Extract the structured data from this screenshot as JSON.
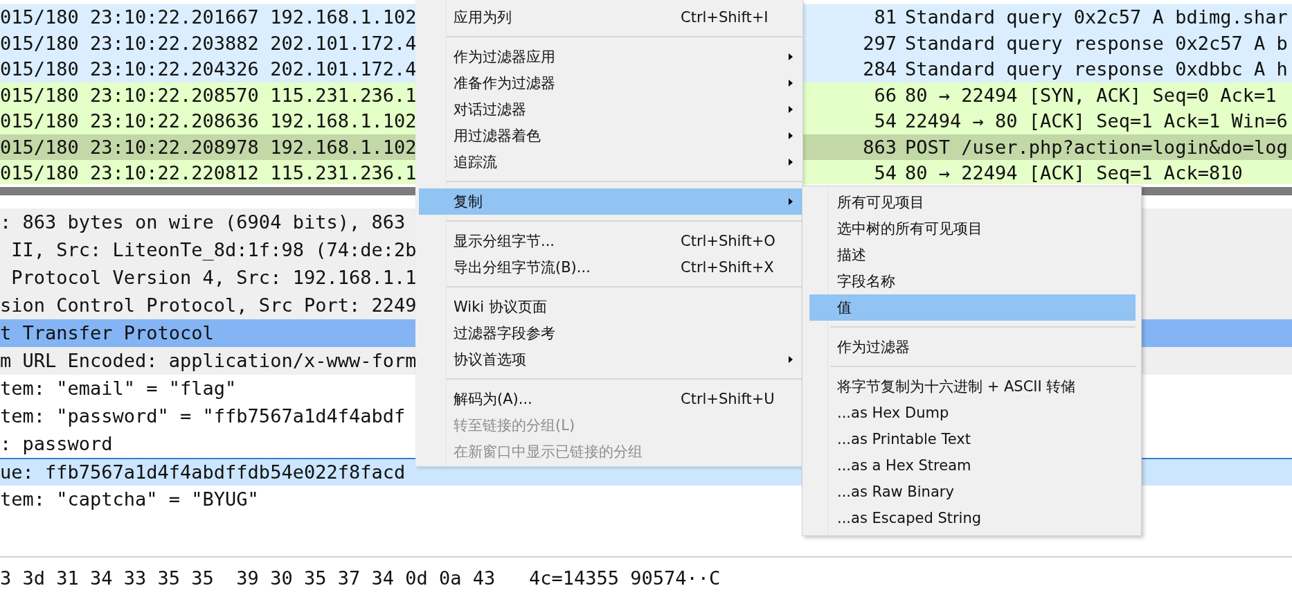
{
  "packet_list": {
    "rows": [
      {
        "summary": "015/180 23:10:22.201667 192.168.1.102",
        "length": "81",
        "info": "Standard query 0x2c57 A bdimg.shar",
        "color": "#daeeff"
      },
      {
        "summary": "015/180 23:10:22.203882 202.101.172.4",
        "length": "297",
        "info": "Standard query response 0x2c57 A b",
        "color": "#daeeff"
      },
      {
        "summary": "015/180 23:10:22.204326 202.101.172.4",
        "length": "284",
        "info": "Standard query response 0xdbbc A h",
        "color": "#daeeff"
      },
      {
        "summary": "015/180 23:10:22.208570 115.231.236.1",
        "length": "66",
        "info": "80 → 22494 [SYN, ACK] Seq=0 Ack=1",
        "color": "#e4ffc7"
      },
      {
        "summary": "015/180 23:10:22.208636 192.168.1.102",
        "length": "54",
        "info": "22494 → 80 [ACK] Seq=1 Ack=1 Win=6",
        "color": "#e4ffc7"
      },
      {
        "summary": "015/180 23:10:22.208978 192.168.1.102",
        "length": "863",
        "info": "POST /user.php?action=login&do=log",
        "color": "#c2d8a7"
      },
      {
        "summary": "015/180 23:10:22.220812 115.231.236.1",
        "length": "54",
        "info": "80 → 22494 [ACK] Seq=1 Ack=810",
        "color": "#e4ffc7"
      }
    ]
  },
  "packet_details": {
    "rows": [
      {
        "text": ": 863 bytes on wire (6904 bits), 863",
        "kind": "protocol",
        "selected": false,
        "highlighted": false
      },
      {
        "text": " II, Src: LiteonTe_8d:1f:98 (74:de:2b",
        "kind": "protocol",
        "selected": false,
        "highlighted": false
      },
      {
        "text": " Protocol Version 4, Src: 192.168.1.1",
        "kind": "protocol",
        "selected": false,
        "highlighted": false
      },
      {
        "text": "sion Control Protocol, Src Port: 2249",
        "kind": "protocol",
        "selected": false,
        "highlighted": false
      },
      {
        "text": "t Transfer Protocol",
        "kind": "protocol",
        "selected": true,
        "highlighted": false
      },
      {
        "text": "m URL Encoded: application/x-www-form",
        "kind": "protocol",
        "selected": false,
        "highlighted": false
      },
      {
        "text": "tem: \"email\" = \"flag\"",
        "kind": "field",
        "selected": false,
        "highlighted": false
      },
      {
        "text": "tem: \"password\" = \"ffb7567a1d4f4abdf",
        "kind": "field",
        "selected": false,
        "highlighted": false
      },
      {
        "text": ": password",
        "kind": "field",
        "selected": false,
        "highlighted": false
      },
      {
        "text": "ue: ffb7567a1d4f4abdffdb54e022f8facd",
        "kind": "field",
        "selected": false,
        "highlighted": true
      },
      {
        "text": "tem: \"captcha\" = \"BYUG\"",
        "kind": "field",
        "selected": false,
        "highlighted": false
      }
    ]
  },
  "packet_bytes": {
    "line": "3 3d 31 34 33 35 35  39 30 35 37 34 0d 0a 43   4c=14355 90574··C"
  },
  "context_menu": {
    "items": [
      {
        "kind": "item",
        "label": "应用为列",
        "shortcut": "Ctrl+Shift+I",
        "submenu": false,
        "disabled": false,
        "selected": false
      },
      {
        "kind": "separator"
      },
      {
        "kind": "item",
        "label": "作为过滤器应用",
        "submenu": true,
        "disabled": false,
        "selected": false
      },
      {
        "kind": "item",
        "label": "准备作为过滤器",
        "submenu": true,
        "disabled": false,
        "selected": false
      },
      {
        "kind": "item",
        "label": "对话过滤器",
        "submenu": true,
        "disabled": false,
        "selected": false
      },
      {
        "kind": "item",
        "label": "用过滤器着色",
        "submenu": true,
        "disabled": false,
        "selected": false
      },
      {
        "kind": "item",
        "label": "追踪流",
        "submenu": true,
        "disabled": false,
        "selected": false
      },
      {
        "kind": "separator"
      },
      {
        "kind": "item",
        "label": "复制",
        "submenu": true,
        "disabled": false,
        "selected": true
      },
      {
        "kind": "separator"
      },
      {
        "kind": "item",
        "label": "显示分组字节...",
        "shortcut": "Ctrl+Shift+O",
        "submenu": false,
        "disabled": false,
        "selected": false
      },
      {
        "kind": "item",
        "label": "导出分组字节流(B)...",
        "shortcut": "Ctrl+Shift+X",
        "submenu": false,
        "disabled": false,
        "selected": false
      },
      {
        "kind": "separator"
      },
      {
        "kind": "item",
        "label": "Wiki 协议页面",
        "submenu": false,
        "disabled": false,
        "selected": false
      },
      {
        "kind": "item",
        "label": "过滤器字段参考",
        "submenu": false,
        "disabled": false,
        "selected": false
      },
      {
        "kind": "item",
        "label": "协议首选项",
        "submenu": true,
        "disabled": false,
        "selected": false
      },
      {
        "kind": "separator"
      },
      {
        "kind": "item",
        "label": "解码为(A)...",
        "shortcut": "Ctrl+Shift+U",
        "submenu": false,
        "disabled": false,
        "selected": false
      },
      {
        "kind": "item",
        "label": "转至链接的分组(L)",
        "submenu": false,
        "disabled": true,
        "selected": false
      },
      {
        "kind": "item",
        "label": "在新窗口中显示已链接的分组",
        "submenu": false,
        "disabled": true,
        "selected": false
      }
    ]
  },
  "copy_submenu": {
    "items": [
      {
        "kind": "item",
        "label": "所有可见项目",
        "selected": false
      },
      {
        "kind": "item",
        "label": "选中树的所有可见项目",
        "selected": false
      },
      {
        "kind": "item",
        "label": "描述",
        "selected": false
      },
      {
        "kind": "item",
        "label": "字段名称",
        "selected": false
      },
      {
        "kind": "item",
        "label": "值",
        "selected": true
      },
      {
        "kind": "separator"
      },
      {
        "kind": "item",
        "label": "作为过滤器",
        "selected": false
      },
      {
        "kind": "separator"
      },
      {
        "kind": "item",
        "label": "将字节复制为十六进制 + ASCII 转储",
        "selected": false
      },
      {
        "kind": "item",
        "label": "...as Hex Dump",
        "selected": false
      },
      {
        "kind": "item",
        "label": "...as Printable Text",
        "selected": false
      },
      {
        "kind": "item",
        "label": "...as a Hex Stream",
        "selected": false
      },
      {
        "kind": "item",
        "label": "...as Raw Binary",
        "selected": false
      },
      {
        "kind": "item",
        "label": "...as Escaped String",
        "selected": false
      }
    ]
  }
}
